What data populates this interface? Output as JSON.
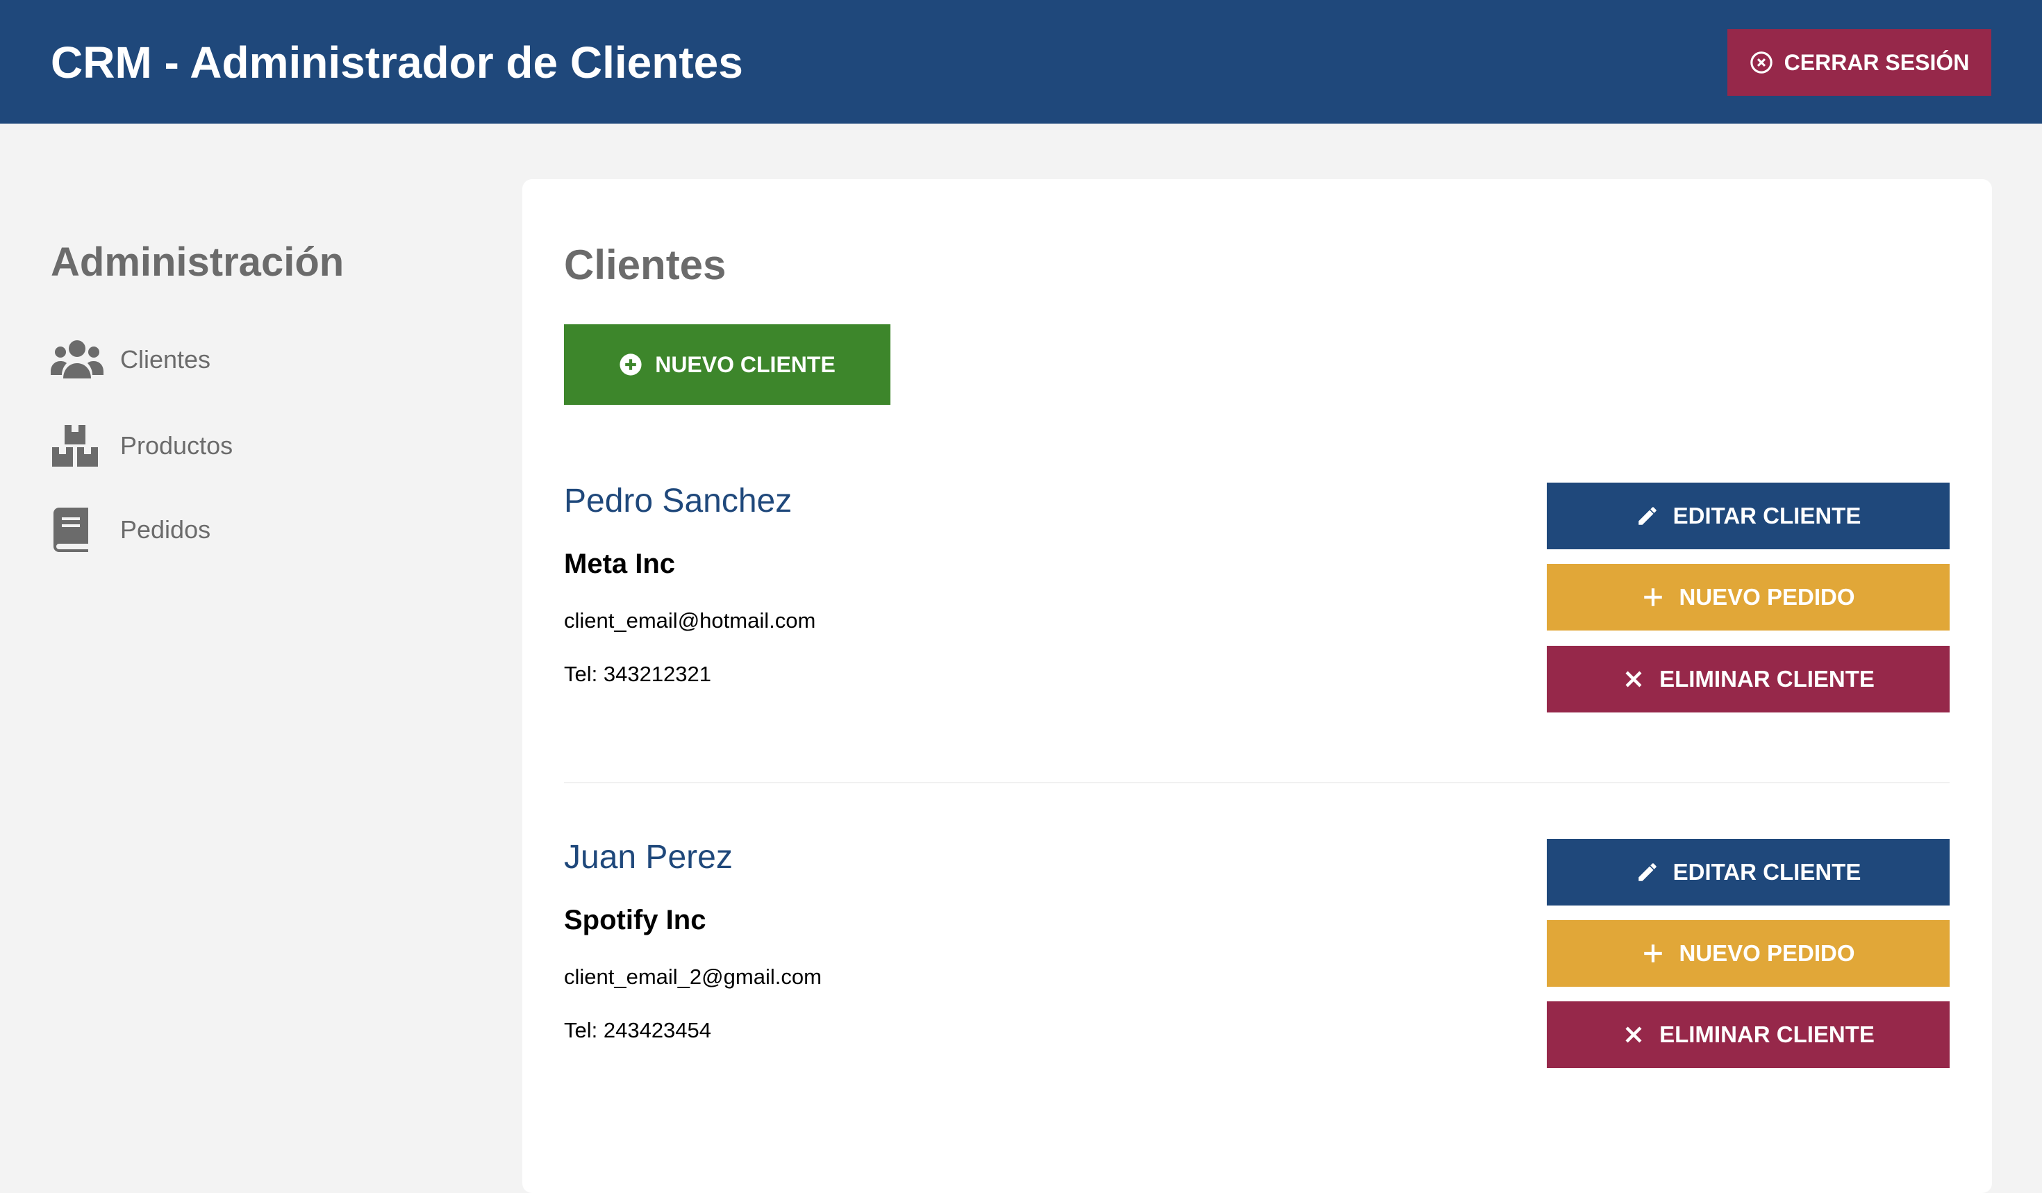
{
  "header": {
    "title": "CRM - Administrador de Clientes",
    "logout_label": "CERRAR SESIÓN"
  },
  "sidebar": {
    "title": "Administración",
    "items": [
      {
        "label": "Clientes",
        "icon": "users-icon"
      },
      {
        "label": "Productos",
        "icon": "boxes-icon"
      },
      {
        "label": "Pedidos",
        "icon": "book-icon"
      }
    ]
  },
  "main": {
    "title": "Clientes",
    "new_client_label": "NUEVO CLIENTE",
    "edit_label": "EDITAR CLIENTE",
    "new_order_label": "NUEVO PEDIDO",
    "delete_label": "ELIMINAR CLIENTE",
    "clients": [
      {
        "name": "Pedro Sanchez",
        "company": "Meta Inc",
        "email": "client_email@hotmail.com",
        "phone": "Tel: 343212321"
      },
      {
        "name": "Juan Perez",
        "company": "Spotify Inc",
        "email": "client_email_2@gmail.com",
        "phone": "Tel: 243423454"
      }
    ]
  },
  "colors": {
    "header_bg": "#1f487b",
    "danger": "#96284a",
    "success": "#3d862b",
    "warning": "#e1a738",
    "text_muted": "#6b6b6b"
  }
}
